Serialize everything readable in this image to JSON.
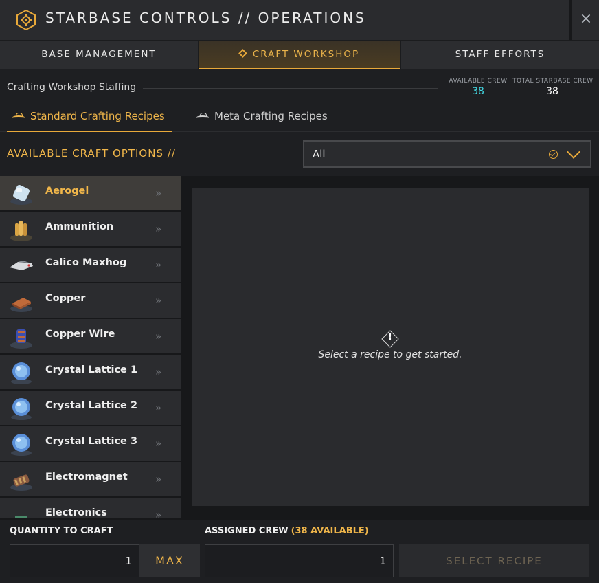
{
  "window": {
    "title": "STARBASE CONTROLS // OPERATIONS",
    "close_label": "×"
  },
  "main_tabs": [
    {
      "label": "BASE MANAGEMENT",
      "active": false
    },
    {
      "label": "CRAFT WORKSHOP",
      "active": true
    },
    {
      "label": "STAFF EFFORTS",
      "active": false
    }
  ],
  "staffing": {
    "label": "Crafting Workshop Staffing",
    "available_crew_label": "AVAILABLE CREW",
    "available_crew_value": "38",
    "total_crew_label": "TOTAL STARBASE CREW",
    "total_crew_value": "38"
  },
  "sub_tabs": [
    {
      "label": "Standard Crafting Recipes",
      "active": true
    },
    {
      "label": "Meta Crafting Recipes",
      "active": false
    }
  ],
  "options": {
    "label": "AVAILABLE CRAFT OPTIONS //",
    "filter_value": "All"
  },
  "recipes": [
    {
      "name": "Aerogel",
      "selected": true,
      "icon": "aerogel-icon"
    },
    {
      "name": "Ammunition",
      "selected": false,
      "icon": "ammunition-icon"
    },
    {
      "name": "Calico Maxhog",
      "selected": false,
      "icon": "ship-icon"
    },
    {
      "name": "Copper",
      "selected": false,
      "icon": "copper-icon"
    },
    {
      "name": "Copper Wire",
      "selected": false,
      "icon": "copper-wire-icon"
    },
    {
      "name": "Crystal Lattice 1",
      "selected": false,
      "icon": "crystal-lattice-icon"
    },
    {
      "name": "Crystal Lattice 2",
      "selected": false,
      "icon": "crystal-lattice-icon"
    },
    {
      "name": "Crystal Lattice 3",
      "selected": false,
      "icon": "crystal-lattice-icon"
    },
    {
      "name": "Electromagnet",
      "selected": false,
      "icon": "electromagnet-icon"
    },
    {
      "name": "Electronics",
      "selected": false,
      "icon": "electronics-icon"
    }
  ],
  "detail": {
    "empty_message": "Select a recipe to get started."
  },
  "bottom": {
    "quantity_label": "QUANTITY TO CRAFT",
    "quantity_value": "1",
    "max_label": "MAX",
    "crew_label": "ASSIGNED CREW",
    "crew_available_text": "(38 AVAILABLE)",
    "crew_value": "1",
    "select_label": "SELECT RECIPE"
  },
  "colors": {
    "accent": "#e8a93a",
    "cyan": "#42d5e0",
    "background": "#1e1f22"
  }
}
